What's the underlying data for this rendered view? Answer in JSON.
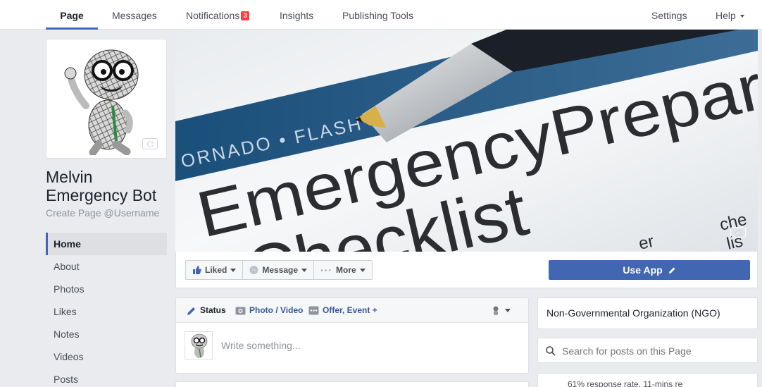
{
  "nav": {
    "items": [
      {
        "label": "Page"
      },
      {
        "label": "Messages"
      },
      {
        "label": "Notifications",
        "badge": "3"
      },
      {
        "label": "Insights"
      },
      {
        "label": "Publishing Tools"
      }
    ],
    "right": [
      {
        "label": "Settings"
      },
      {
        "label": "Help"
      }
    ],
    "accent": "#4267b2",
    "badge_color": "#fa3e3e"
  },
  "profile": {
    "name_line1": "Melvin",
    "name_line2": "Emergency Bot",
    "username": "Create Page @Username"
  },
  "sidebar": {
    "items": [
      {
        "label": "Home"
      },
      {
        "label": "About"
      },
      {
        "label": "Photos"
      },
      {
        "label": "Likes"
      },
      {
        "label": "Notes"
      },
      {
        "label": "Videos"
      },
      {
        "label": "Posts"
      }
    ]
  },
  "cover": {
    "text_line1": "EmergencyPrepar",
    "text_line2": "Checklist",
    "band_text": "ORNADO • FLASH",
    "side_text1": "che",
    "side_text2": "lis",
    "bottom_text": "er"
  },
  "actions": {
    "liked": "Liked",
    "message": "Message",
    "more": "More",
    "use_app": "Use App"
  },
  "composer": {
    "status": "Status",
    "photo_video": "Photo / Video",
    "offer_event": "Offer, Event +",
    "placeholder": "Write something..."
  },
  "about": {
    "category": "Non-Governmental Organization (NGO)",
    "search_placeholder": "Search for posts on this Page",
    "response": "61% response rate, 11-mins re"
  }
}
